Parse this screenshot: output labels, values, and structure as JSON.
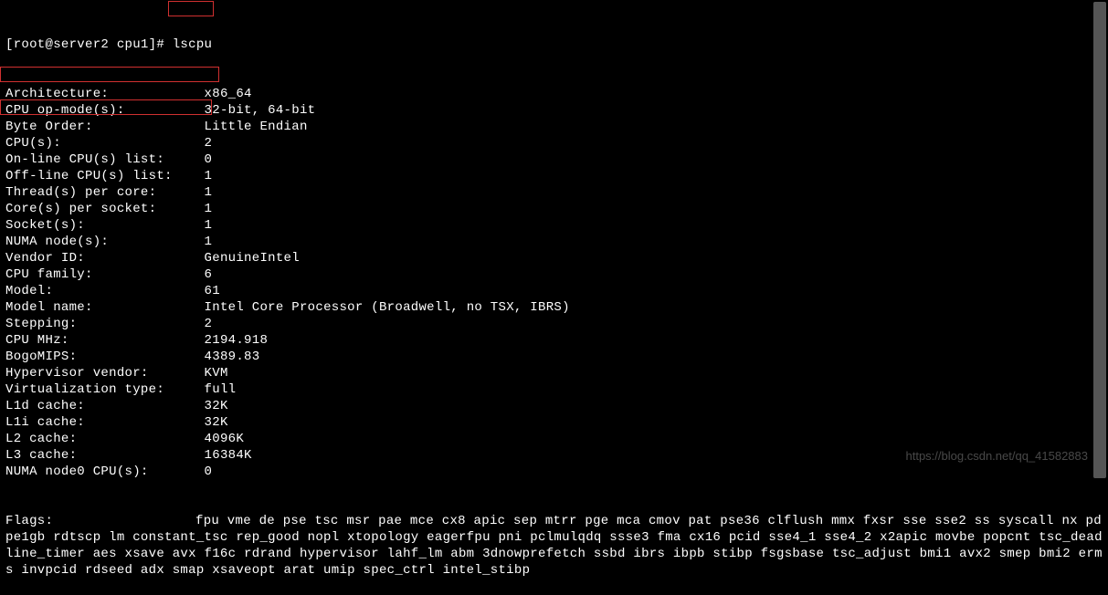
{
  "prompt": "[root@server2 cpu1]# ",
  "command": "lscpu",
  "rows": [
    {
      "label": "Architecture:",
      "value": "x86_64"
    },
    {
      "label": "CPU op-mode(s):",
      "value": "32-bit, 64-bit"
    },
    {
      "label": "Byte Order:",
      "value": "Little Endian"
    },
    {
      "label": "CPU(s):",
      "value": "2"
    },
    {
      "label": "On-line CPU(s) list:",
      "value": "0"
    },
    {
      "label": "Off-line CPU(s) list:",
      "value": "1"
    },
    {
      "label": "Thread(s) per core:",
      "value": "1"
    },
    {
      "label": "Core(s) per socket:",
      "value": "1"
    },
    {
      "label": "Socket(s):",
      "value": "1"
    },
    {
      "label": "NUMA node(s):",
      "value": "1"
    },
    {
      "label": "Vendor ID:",
      "value": "GenuineIntel"
    },
    {
      "label": "CPU family:",
      "value": "6"
    },
    {
      "label": "Model:",
      "value": "61"
    },
    {
      "label": "Model name:",
      "value": "Intel Core Processor (Broadwell, no TSX, IBRS)"
    },
    {
      "label": "Stepping:",
      "value": "2"
    },
    {
      "label": "CPU MHz:",
      "value": "2194.918"
    },
    {
      "label": "BogoMIPS:",
      "value": "4389.83"
    },
    {
      "label": "Hypervisor vendor:",
      "value": "KVM"
    },
    {
      "label": "Virtualization type:",
      "value": "full"
    },
    {
      "label": "L1d cache:",
      "value": "32K"
    },
    {
      "label": "L1i cache:",
      "value": "32K"
    },
    {
      "label": "L2 cache:",
      "value": "4096K"
    },
    {
      "label": "L3 cache:",
      "value": "16384K"
    },
    {
      "label": "NUMA node0 CPU(s):",
      "value": "0"
    }
  ],
  "flags_label": "Flags:",
  "flags_value": "fpu vme de pse tsc msr pae mce cx8 apic sep mtrr pge mca cmov pat pse36 clflush mmx fxsr sse sse2 ss syscall nx pdpe1gb rdtscp lm constant_tsc rep_good nopl xtopology eagerfpu pni pclmulqdq ssse3 fma cx16 pcid sse4_1 sse4_2 x2apic movbe popcnt tsc_deadline_timer aes xsave avx f16c rdrand hypervisor lahf_lm abm 3dnowprefetch ssbd ibrs ibpb stibp fsgsbase tsc_adjust bmi1 avx2 smep bmi2 erms invpcid rdseed adx smap xsaveopt arat umip spec_ctrl intel_stibp",
  "watermark": "https://blog.csdn.net/qq_41582883"
}
